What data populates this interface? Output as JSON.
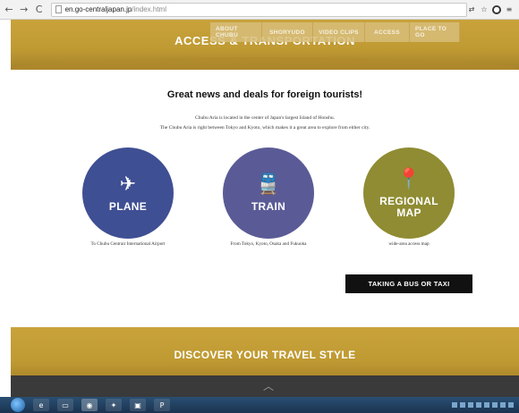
{
  "browser": {
    "back": "←",
    "forward": "→",
    "reload": "C",
    "url_host": "en.go-centraljapan.jp",
    "url_path": "/index.html"
  },
  "hero": {
    "title": "ACCESS & TRANSPORTATION"
  },
  "topnav": {
    "items": [
      "ABOUT CHUBU",
      "SHORYUDO",
      "VIDEO CLIPS",
      "ACCESS",
      "PLACE TO GO"
    ]
  },
  "main": {
    "headline": "Great news and deals for foreign tourists!",
    "intro_line1": "Chubu Aria is located in the center of Japan's largest Island of Honshu.",
    "intro_line2": "The Chubu Aria is right between Tokyo and Kyoto, which makes it a great area to explore from either city.",
    "cards": [
      {
        "label": "PLANE",
        "icon": "plane-icon",
        "glyph": "✈",
        "caption": "To Chubu Centrair International Airport",
        "color": "#3f4f93"
      },
      {
        "label": "TRAIN",
        "icon": "train-icon",
        "glyph": "🚆",
        "caption": "From Tokyo, Kyoto, Osaka and Fukuoka",
        "color": "#5a5b96"
      },
      {
        "label": "REGIONAL MAP",
        "icon": "map-pin-icon",
        "glyph": "📍",
        "caption": "wide-area access map",
        "color": "#8f8c33"
      }
    ],
    "bus_button": "TAKING A BUS OR TAXI"
  },
  "discover": {
    "title": "DISCOVER YOUR TRAVEL STYLE"
  }
}
